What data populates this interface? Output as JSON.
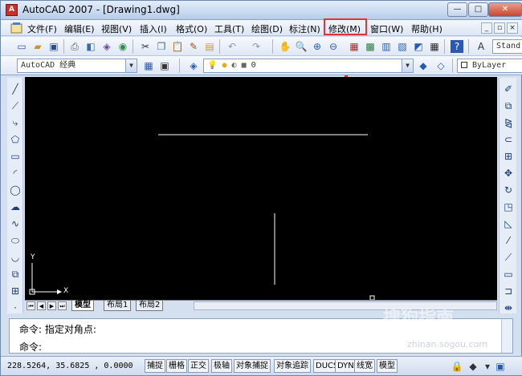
{
  "window": {
    "title": "AutoCAD 2007 - [Drawing1.dwg]",
    "app_logo": "A"
  },
  "menu": {
    "items": [
      "文件(F)",
      "编辑(E)",
      "视图(V)",
      "插入(I)",
      "格式(O)",
      "工具(T)",
      "绘图(D)",
      "标注(N)",
      "修改(M)",
      "窗口(W)",
      "帮助(H)"
    ],
    "highlighted": "修改(M)",
    "highlight_color": "#e4323a"
  },
  "toolbar": {
    "workspace": "AutoCAD 经典",
    "text_style_label": "Stand",
    "layer_value": "0",
    "color_value": "ByLayer"
  },
  "layout_tabs": [
    "模型",
    "布局1",
    "布局2"
  ],
  "axis": {
    "x_label": "X",
    "y_label": "Y"
  },
  "command_line": {
    "history": "命令: 指定对角点:",
    "prompt": "命令:"
  },
  "status": {
    "coordinates": "228.5264,  35.6825 , 0.0000",
    "toggles": [
      "捕捉",
      "栅格",
      "正交",
      "极轴",
      "对象捕捉",
      "对象追踪",
      "DUCS",
      "DYN",
      "线宽",
      "模型"
    ]
  },
  "watermark": {
    "main": "搜狗指南",
    "sub": "zhinan.sogou.com"
  }
}
